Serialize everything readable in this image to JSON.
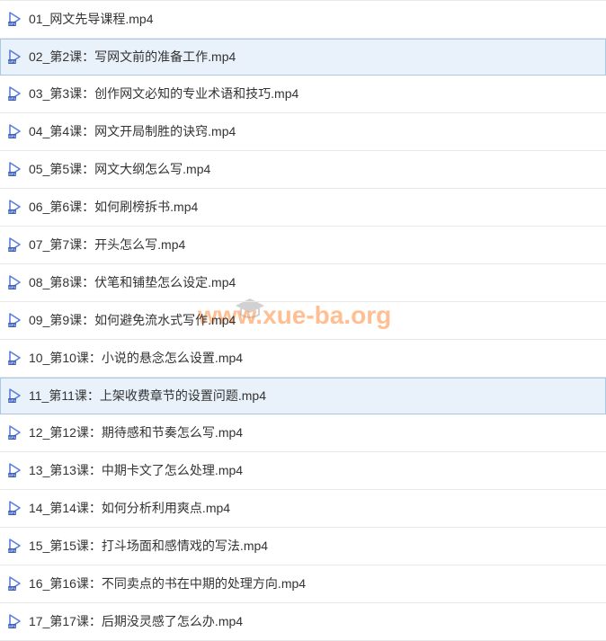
{
  "watermark": {
    "text": "www.xue-ba.org"
  },
  "files": [
    {
      "name": "01_网文先导课程.mp4",
      "selected": false
    },
    {
      "name": "02_第2课：写网文前的准备工作.mp4",
      "selected": true
    },
    {
      "name": "03_第3课：创作网文必知的专业术语和技巧.mp4",
      "selected": false
    },
    {
      "name": "04_第4课：网文开局制胜的诀窍.mp4",
      "selected": false
    },
    {
      "name": "05_第5课：网文大纲怎么写.mp4",
      "selected": false
    },
    {
      "name": "06_第6课：如何刷榜拆书.mp4",
      "selected": false
    },
    {
      "name": "07_第7课：开头怎么写.mp4",
      "selected": false
    },
    {
      "name": "08_第8课：伏笔和铺垫怎么设定.mp4",
      "selected": false
    },
    {
      "name": "09_第9课：如何避免流水式写作.mp4",
      "selected": false
    },
    {
      "name": "10_第10课：小说的悬念怎么设置.mp4",
      "selected": false
    },
    {
      "name": "11_第11课：上架收费章节的设置问题.mp4",
      "selected": true
    },
    {
      "name": "12_第12课：期待感和节奏怎么写.mp4",
      "selected": false
    },
    {
      "name": "13_第13课：中期卡文了怎么处理.mp4",
      "selected": false
    },
    {
      "name": "14_第14课：如何分析利用爽点.mp4",
      "selected": false
    },
    {
      "name": "15_第15课：打斗场面和感情戏的写法.mp4",
      "selected": false
    },
    {
      "name": "16_第16课：不同卖点的书在中期的处理方向.mp4",
      "selected": false
    },
    {
      "name": "17_第17课：后期没灵感了怎么办.mp4",
      "selected": false
    }
  ]
}
